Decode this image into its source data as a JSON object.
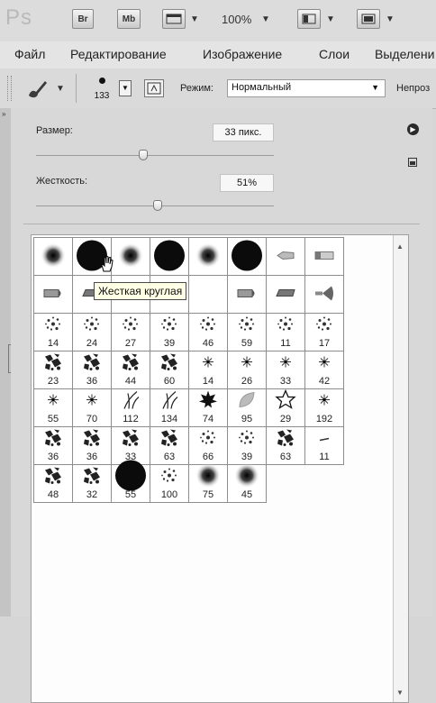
{
  "app": {
    "logo": "Ps",
    "bridge_label": "Br",
    "minibridge_label": "Mb",
    "zoom": "100%"
  },
  "menubar": {
    "items": [
      "Файл",
      "Редактирование",
      "Изображение",
      "Слои",
      "Выделени"
    ]
  },
  "options": {
    "brush_size": "133",
    "mode_label": "Режим:",
    "mode_value": "Нормальный",
    "opacity_label": "Непроз"
  },
  "panel": {
    "size_label": "Размер:",
    "size_value": "33 пикс.",
    "size_slider_percent": 45,
    "hardness_label": "Жесткость:",
    "hardness_value": "51%",
    "hardness_slider_percent": 51
  },
  "tooltip": "Жесткая круглая",
  "brushes": [
    [
      {
        "icon": "soft-round-brush-icon",
        "size": ""
      },
      {
        "icon": "hard-round-brush-icon",
        "size": ""
      },
      {
        "icon": "soft-round-brush-icon",
        "size": ""
      },
      {
        "icon": "hard-round-brush-icon",
        "size": ""
      },
      {
        "icon": "soft-round-brush-icon",
        "size": ""
      },
      {
        "icon": "hard-round-brush-icon",
        "size": ""
      },
      {
        "icon": "chisel-brush-icon",
        "size": ""
      },
      {
        "icon": "flat-brush-icon",
        "size": ""
      }
    ],
    [
      {
        "icon": "blunt-brush-icon",
        "size": ""
      },
      {
        "icon": "angled-brush-icon",
        "size": ""
      },
      {
        "icon": "hidden-brush-icon",
        "size": ""
      },
      {
        "icon": "hidden-brush-icon",
        "size": ""
      },
      {
        "icon": "hidden-brush-icon",
        "size": ""
      },
      {
        "icon": "blunt-brush-icon",
        "size": ""
      },
      {
        "icon": "angled-brush-icon",
        "size": ""
      },
      {
        "icon": "fan-brush-icon",
        "size": ""
      }
    ],
    [
      {
        "icon": "scatter-brush-icon",
        "size": "14"
      },
      {
        "icon": "scatter-brush-icon",
        "size": "24"
      },
      {
        "icon": "scatter-brush-icon",
        "size": "27"
      },
      {
        "icon": "scatter-brush-icon",
        "size": "39"
      },
      {
        "icon": "scatter-brush-icon",
        "size": "46"
      },
      {
        "icon": "scatter-brush-icon",
        "size": "59"
      },
      {
        "icon": "scatter-brush-icon",
        "size": "11"
      },
      {
        "icon": "scatter-brush-icon",
        "size": "17"
      }
    ],
    [
      {
        "icon": "texture-brush-icon",
        "size": "23"
      },
      {
        "icon": "texture-brush-icon",
        "size": "36"
      },
      {
        "icon": "texture-brush-icon",
        "size": "44"
      },
      {
        "icon": "texture-brush-icon",
        "size": "60"
      },
      {
        "icon": "star-spark-brush-icon",
        "size": "14"
      },
      {
        "icon": "star-spark-brush-icon",
        "size": "26"
      },
      {
        "icon": "star-spark-brush-icon",
        "size": "33"
      },
      {
        "icon": "star-spark-brush-icon",
        "size": "42"
      }
    ],
    [
      {
        "icon": "star-spark-brush-icon",
        "size": "55"
      },
      {
        "icon": "star-spark-brush-icon",
        "size": "70"
      },
      {
        "icon": "grass-blade-brush-icon",
        "size": "112"
      },
      {
        "icon": "grass-blade-brush-icon",
        "size": "134"
      },
      {
        "icon": "maple-leaf-brush-icon",
        "size": "74"
      },
      {
        "icon": "leaf-brush-icon",
        "size": "95"
      },
      {
        "icon": "star-outline-brush-icon",
        "size": "29"
      },
      {
        "icon": "star-spark-brush-icon",
        "size": "192"
      }
    ],
    [
      {
        "icon": "texture-brush-icon",
        "size": "36"
      },
      {
        "icon": "texture-brush-icon",
        "size": "36"
      },
      {
        "icon": "texture-brush-icon",
        "size": "33"
      },
      {
        "icon": "texture-brush-icon",
        "size": "63"
      },
      {
        "icon": "scatter-brush-icon",
        "size": "66"
      },
      {
        "icon": "scatter-brush-icon",
        "size": "39"
      },
      {
        "icon": "texture-brush-icon",
        "size": "63"
      },
      {
        "icon": "dash-brush-icon",
        "size": "11"
      }
    ],
    [
      {
        "icon": "texture-brush-icon",
        "size": "48"
      },
      {
        "icon": "texture-brush-icon",
        "size": "32"
      },
      {
        "icon": "hard-round-brush-icon",
        "size": "55"
      },
      {
        "icon": "scatter-brush-icon",
        "size": "100"
      },
      {
        "icon": "soft-round-brush-icon",
        "size": "75"
      },
      {
        "icon": "soft-round-brush-icon",
        "size": "45"
      }
    ]
  ]
}
